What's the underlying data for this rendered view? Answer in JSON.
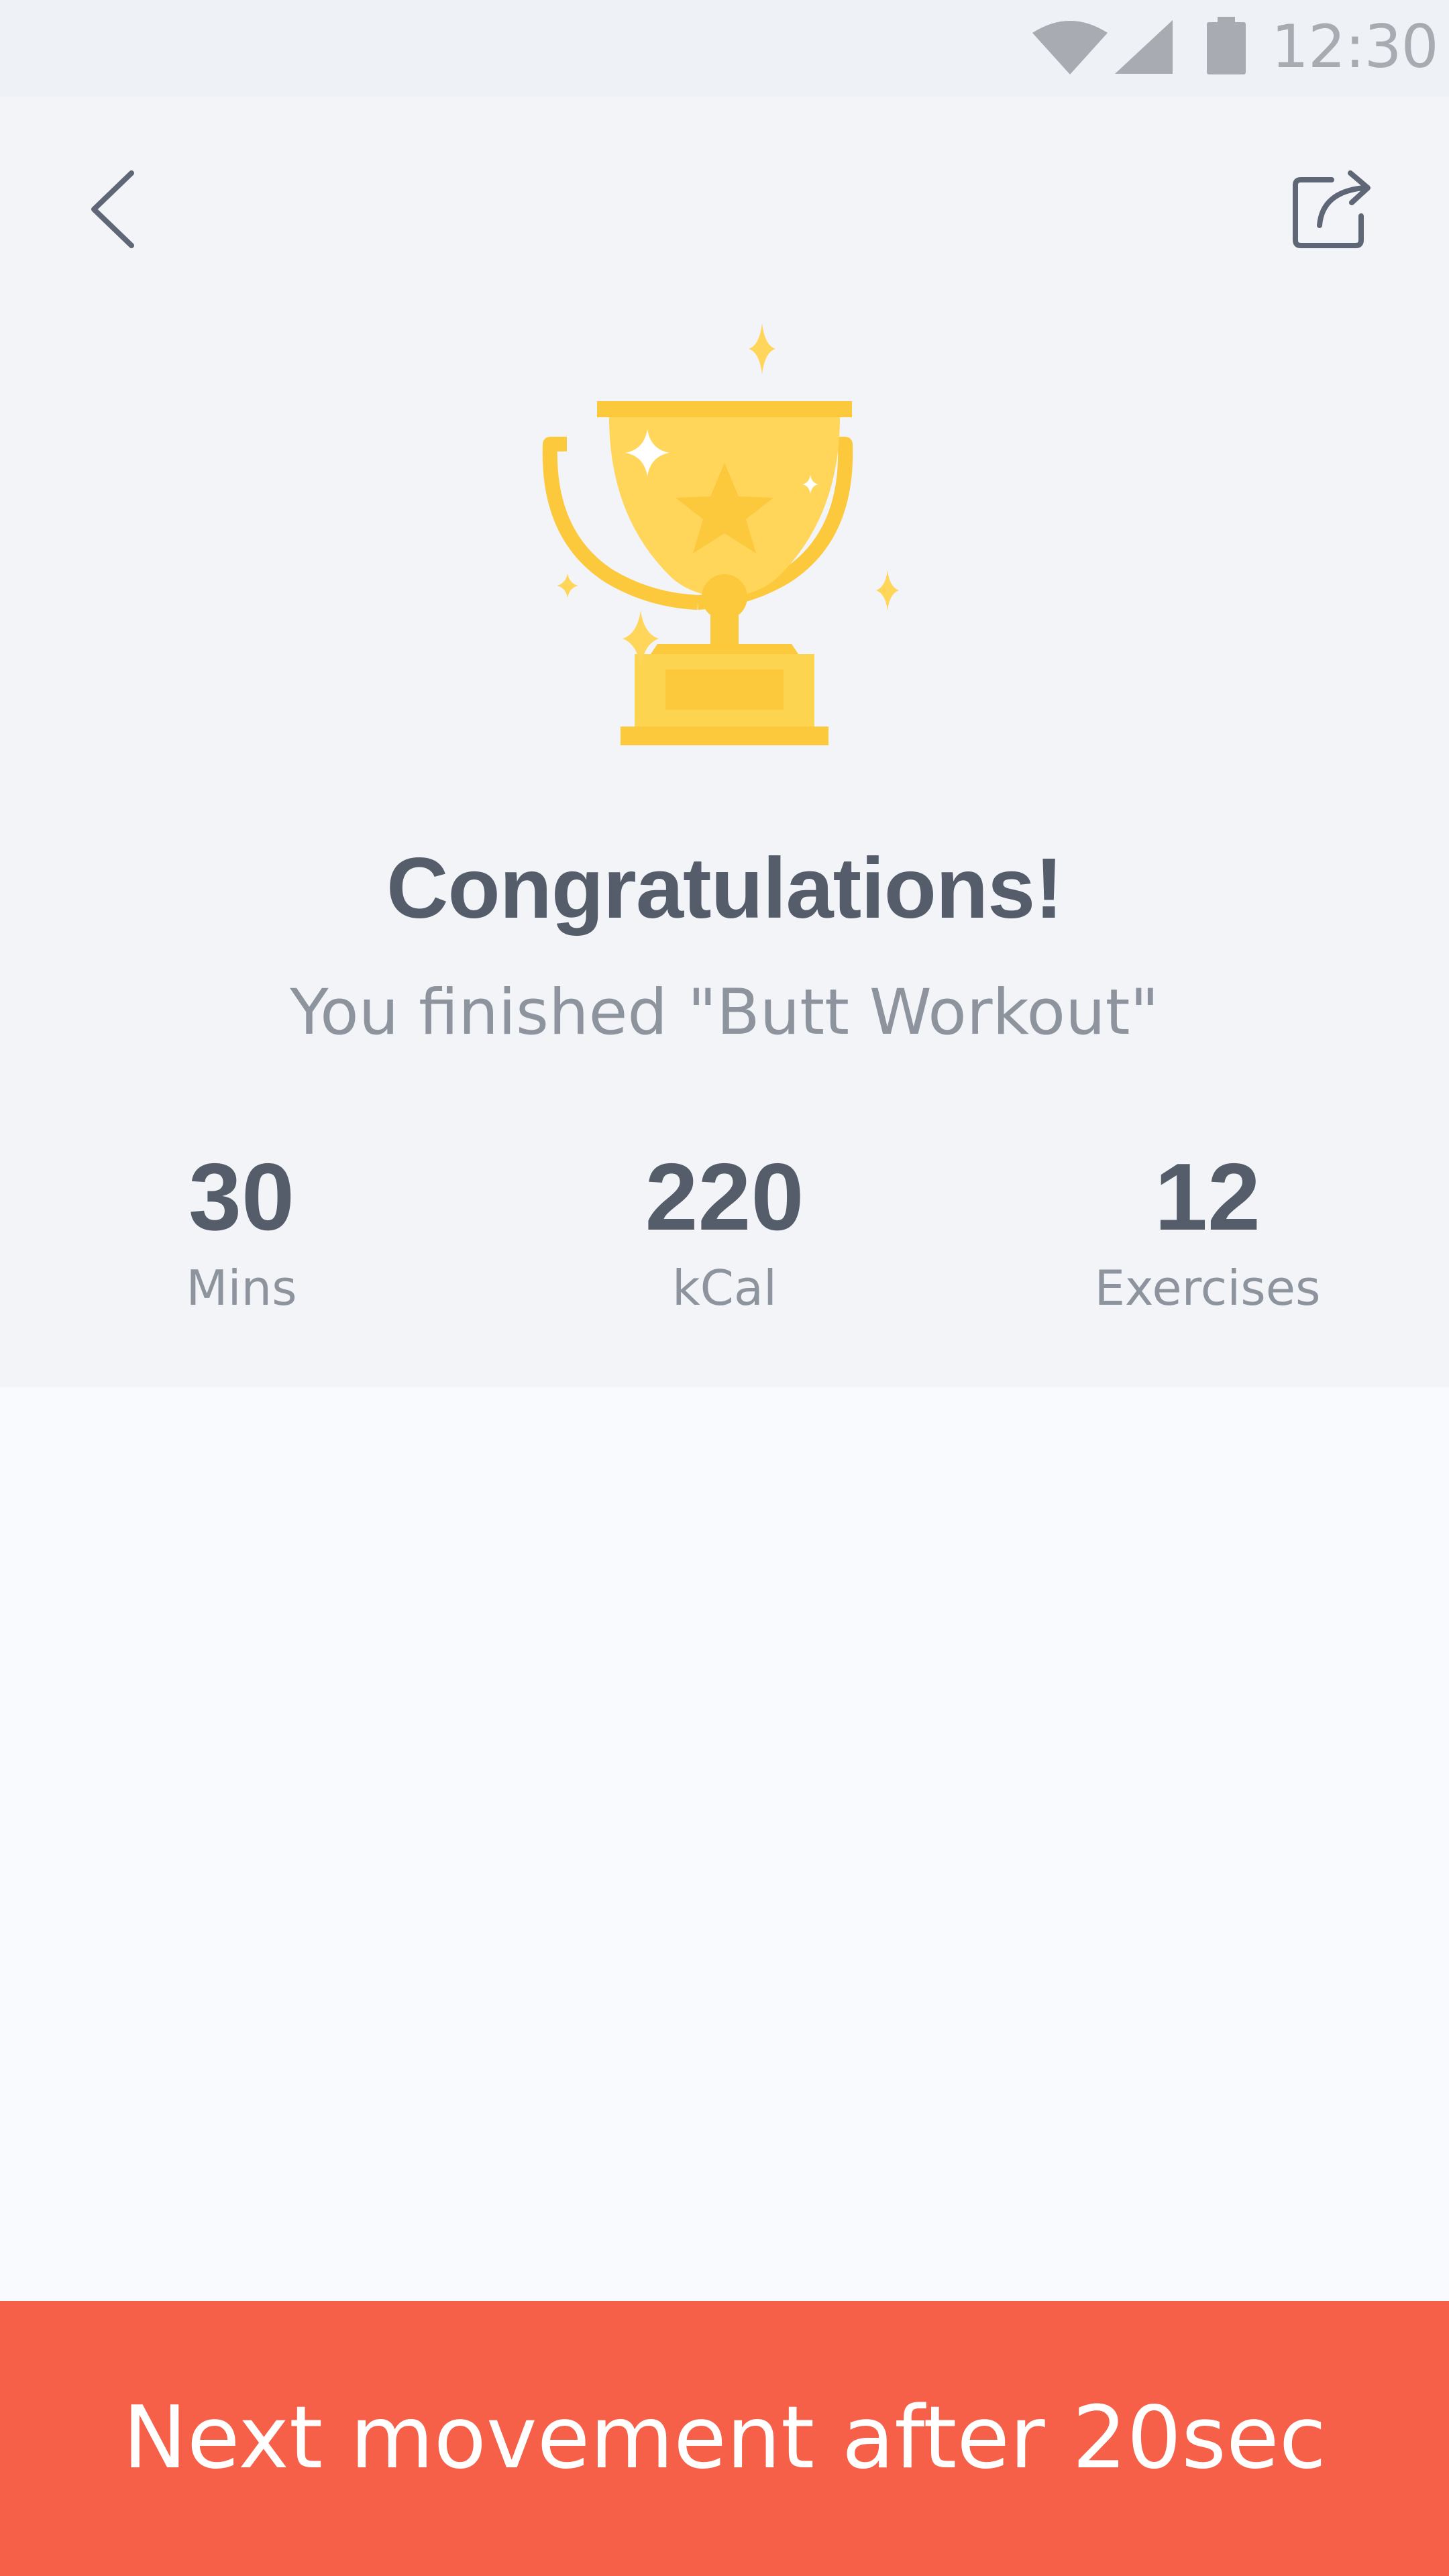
{
  "status_bar": {
    "time": "12:30",
    "icons": [
      "wifi-icon",
      "cellular-signal-icon",
      "battery-icon"
    ]
  },
  "toolbar": {
    "back_icon": "chevron-left-icon",
    "share_icon": "share-icon"
  },
  "hero": {
    "illustration": "trophy-icon",
    "title": "Congratulations!",
    "subtitle": "You finished \"Butt Workout\""
  },
  "stats": [
    {
      "value": "30",
      "unit": "Mins"
    },
    {
      "value": "220",
      "unit": "kCal"
    },
    {
      "value": "12",
      "unit": "Exercises"
    }
  ],
  "next_action": {
    "label": "Next movement after 20sec"
  },
  "colors": {
    "accent": "#f65f48",
    "trophy": "#fcc83c",
    "text_primary": "#555d6b",
    "text_secondary": "#8e949d",
    "hero_bg": "#f2f4f8"
  }
}
